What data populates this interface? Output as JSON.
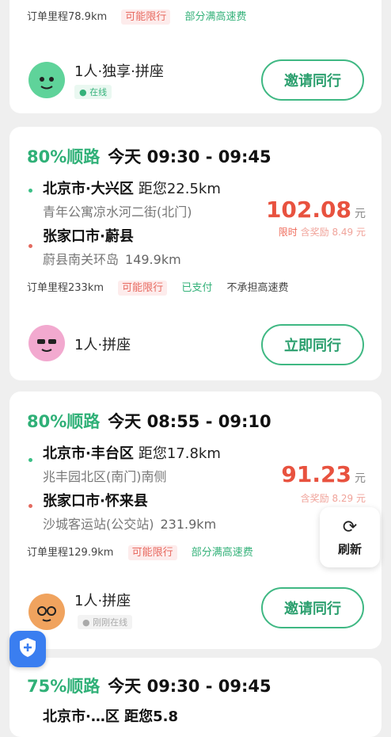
{
  "card0": {
    "tags": [
      "订单里程78.9km",
      "可能限行",
      "部分满高速费"
    ],
    "seat_label": "1人·独享·拼座",
    "status": "● 在线",
    "action": "邀请同行"
  },
  "card1": {
    "match": "80%顺路",
    "time": "今天 09:30 - 09:45",
    "from_city": "北京市·大兴区",
    "from_dist": "距您22.5km",
    "from_addr": "青年公寓凉水河二街(北门)",
    "to_city": "张家口市·蔚县",
    "to_addr": "蔚县南关环岛",
    "to_km": "149.9km",
    "price": "102.08",
    "unit": "元",
    "price_note_label": "限时",
    "price_note": "含奖励 8.49 元",
    "tags": [
      "订单里程233km",
      "可能限行",
      "已支付",
      "不承担高速费"
    ],
    "seat_label": "1人·拼座",
    "action": "立即同行"
  },
  "card2": {
    "match": "80%顺路",
    "time": "今天 08:55 - 09:10",
    "from_city": "北京市·丰台区",
    "from_dist": "距您17.8km",
    "from_addr": "兆丰园北区(南门)南侧",
    "to_city": "张家口市·怀来县",
    "to_addr": "沙城客运站(公交站)",
    "to_km": "231.9km",
    "price": "91.23",
    "unit": "元",
    "price_note": "含奖励 8.29 元",
    "tags": [
      "订单里程129.9km",
      "可能限行",
      "部分满高速费"
    ],
    "seat_label": "1人·拼座",
    "status": "● 刚刚在线",
    "action": "邀请同行"
  },
  "card3": {
    "match": "75%顺路",
    "time": "今天 09:30 - 09:45",
    "from_partial": "北京市·…区 距您5.8"
  },
  "refresh": {
    "label": "刷新"
  },
  "colors": {
    "accent": "#2fb077",
    "price": "#e8523f"
  }
}
